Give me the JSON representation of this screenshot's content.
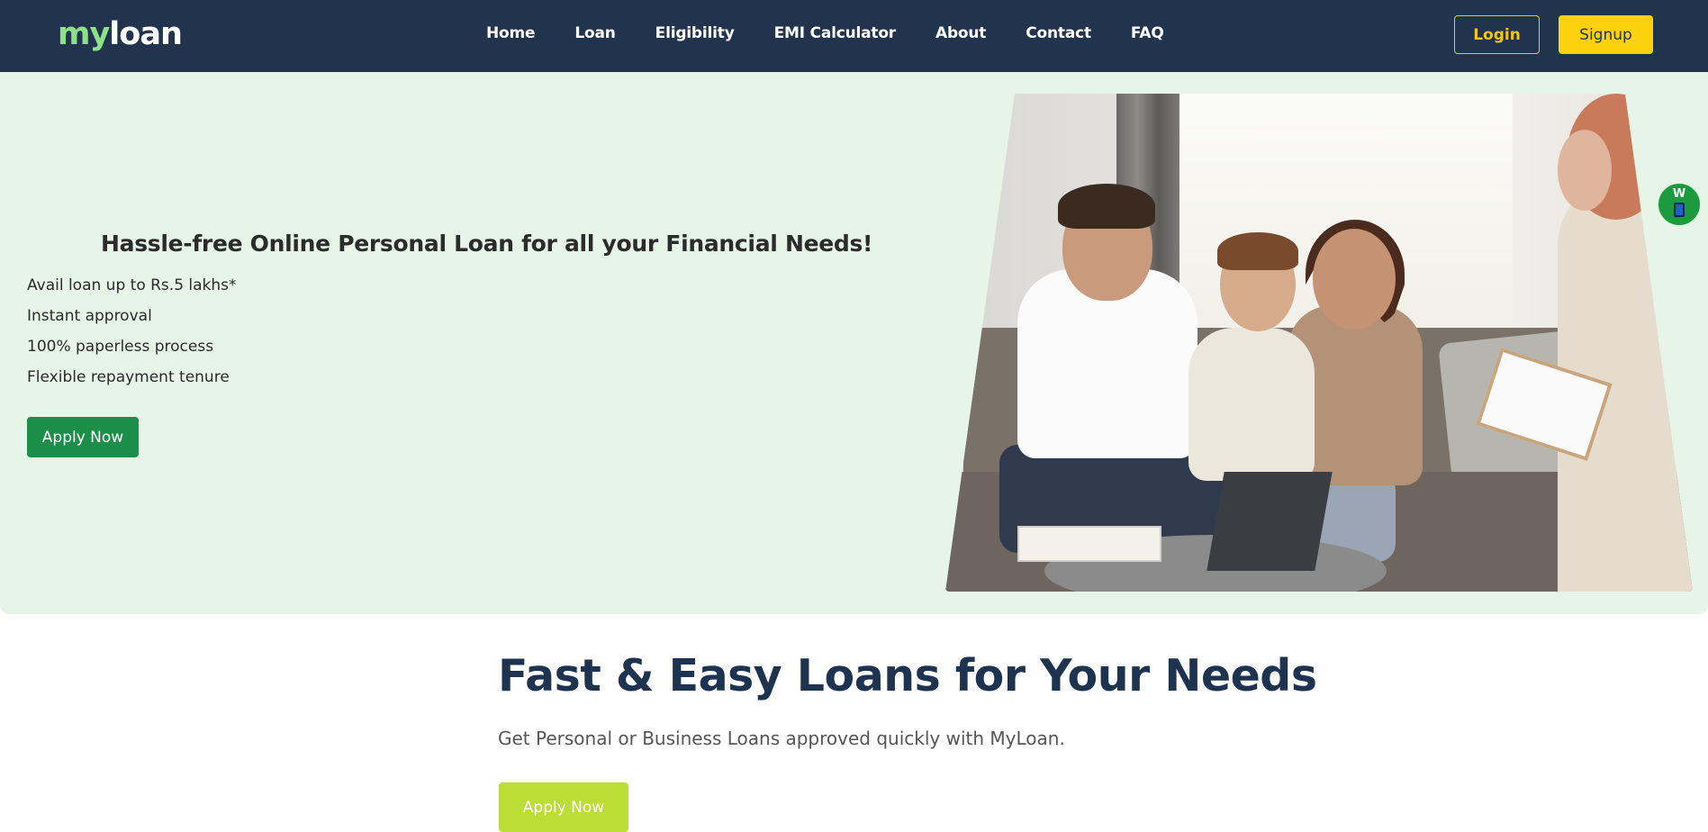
{
  "navbar": {
    "logo_part1": "my",
    "logo_part2": "loan",
    "links": [
      "Home",
      "Loan",
      "Eligibility",
      "EMI Calculator",
      "About",
      "Contact",
      "FAQ"
    ],
    "login_label": "Login",
    "signup_label": "Signup"
  },
  "hero": {
    "title": "Hassle-free Online Personal Loan for all your Financial Needs!",
    "features": [
      "Avail loan up to Rs.5 lakhs*",
      "Instant approval",
      "100% paperless process",
      "Flexible repayment tenure"
    ],
    "apply_label": "Apply Now"
  },
  "chat_widget": {
    "label": "W",
    "icon": "phone-icon"
  },
  "section2": {
    "title": "Fast & Easy Loans for Your Needs",
    "subtitle": "Get Personal or Business Loans approved quickly with MyLoan.",
    "apply_label": "Apply Now"
  },
  "colors": {
    "navbar_bg": "#22344d",
    "logo_accent": "#8ee08a",
    "login_border": "#f5c518",
    "signup_bg": "#fdd10e",
    "hero_bg": "#e7f5e9",
    "hero_button": "#1b8f4a",
    "section2_title": "#1e334f",
    "section2_button": "#bcdc36",
    "chat_bubble": "#1b9b3e"
  }
}
